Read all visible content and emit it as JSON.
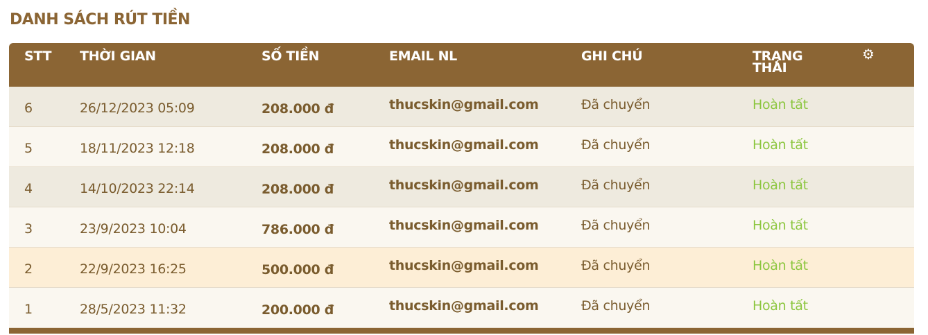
{
  "title": "DANH SÁCH RÚT TIỀN",
  "columns": [
    "STT",
    "THỜI GIAN",
    "SỐ TIỀN",
    "EMAIL NL",
    "GHI CHÚ",
    "TRẠNG\nTHÁI"
  ],
  "settings_icon": "gear-icon",
  "colors": {
    "header": "#8b6534",
    "row_odd": "#eeeadf",
    "row_even": "#faf7f0",
    "row_highlight": "#fdeed6",
    "status": "#8cc63f"
  },
  "rows": [
    {
      "stt": "6",
      "time": "26/12/2023 05:09",
      "amount": "208.000 đ",
      "email": "thucskin@gmail.com",
      "note": "Đã chuyển",
      "status": "Hoàn tất"
    },
    {
      "stt": "5",
      "time": "18/11/2023 12:18",
      "amount": "208.000 đ",
      "email": "thucskin@gmail.com",
      "note": "Đã chuyển",
      "status": "Hoàn tất"
    },
    {
      "stt": "4",
      "time": "14/10/2023 22:14",
      "amount": "208.000 đ",
      "email": "thucskin@gmail.com",
      "note": "Đã chuyển",
      "status": "Hoàn tất"
    },
    {
      "stt": "3",
      "time": "23/9/2023 10:04",
      "amount": "786.000 đ",
      "email": "thucskin@gmail.com",
      "note": "Đã chuyển",
      "status": "Hoàn tất"
    },
    {
      "stt": "2",
      "time": "22/9/2023 16:25",
      "amount": "500.000 đ",
      "email": "thucskin@gmail.com",
      "note": "Đã chuyển",
      "status": "Hoàn tất"
    },
    {
      "stt": "1",
      "time": "28/5/2023 11:32",
      "amount": "200.000 đ",
      "email": "thucskin@gmail.com",
      "note": "Đã chuyển",
      "status": "Hoàn tất"
    }
  ]
}
